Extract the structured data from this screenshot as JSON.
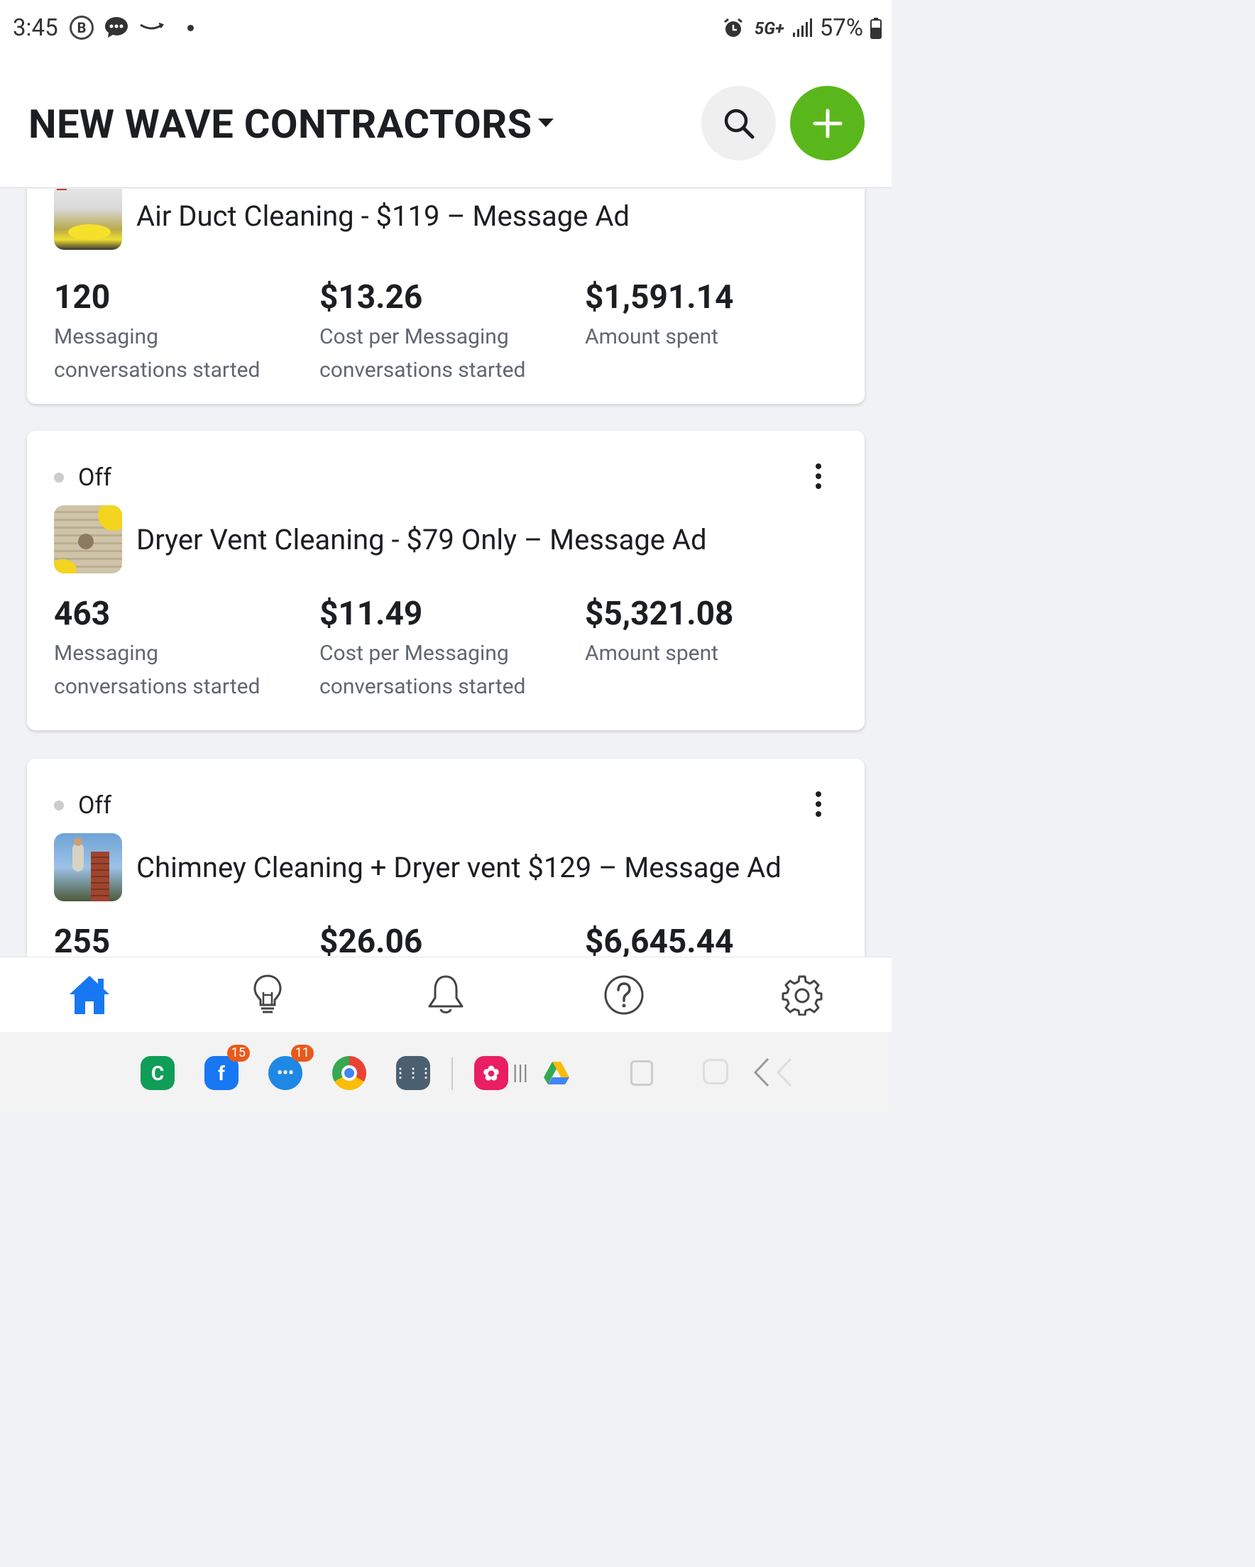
{
  "status_bar": {
    "time": "3:45",
    "network": "5G+",
    "battery": "57%"
  },
  "header": {
    "account_name": "NEW WAVE CONTRACTORS"
  },
  "ads": [
    {
      "status": "",
      "name": "Air Duct Cleaning - $119 – Message Ad",
      "metrics": [
        {
          "value": "120",
          "label_line1": "Messaging",
          "label_line2": "conversations started"
        },
        {
          "value": "$13.26",
          "label_line1": "Cost per Messaging",
          "label_line2": "conversations started"
        },
        {
          "value": "$1,591.14",
          "label_line1": "Amount spent",
          "label_line2": ""
        }
      ]
    },
    {
      "status": "Off",
      "name": "Dryer Vent Cleaning - $79 Only – Message Ad",
      "metrics": [
        {
          "value": "463",
          "label_line1": "Messaging",
          "label_line2": "conversations started"
        },
        {
          "value": "$11.49",
          "label_line1": "Cost per Messaging",
          "label_line2": "conversations started"
        },
        {
          "value": "$5,321.08",
          "label_line1": "Amount spent",
          "label_line2": ""
        }
      ]
    },
    {
      "status": "Off",
      "name": "Chimney Cleaning + Dryer vent $129 – Message Ad",
      "metrics": [
        {
          "value": "255",
          "label_line1": "",
          "label_line2": ""
        },
        {
          "value": "$26.06",
          "label_line1": "",
          "label_line2": ""
        },
        {
          "value": "$6,645.44",
          "label_line1": "",
          "label_line2": ""
        }
      ]
    }
  ],
  "bottom_nav": [
    "home-icon",
    "lightbulb-icon",
    "bell-icon",
    "help-icon",
    "gear-icon"
  ],
  "system_bar": {
    "facebook_badge": "15",
    "messages_badge": "11"
  },
  "colors": {
    "accent_green": "#5ab71b",
    "nav_active_blue": "#1877f2"
  }
}
